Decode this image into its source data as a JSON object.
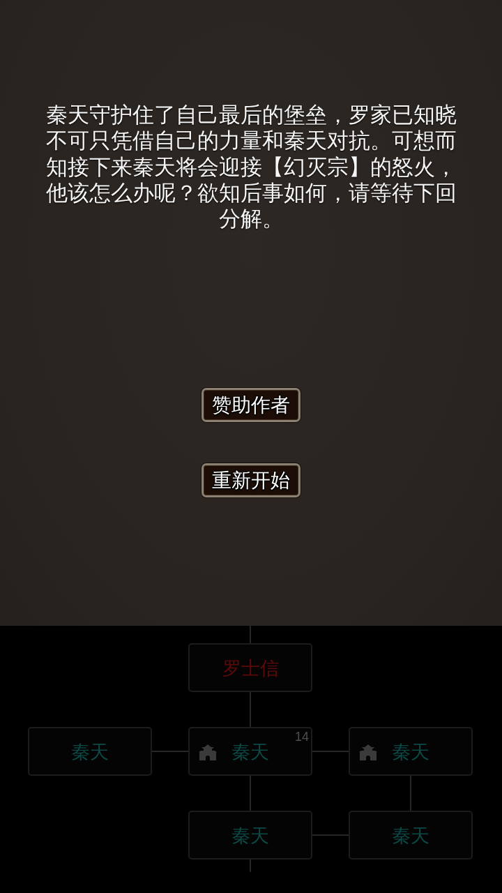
{
  "story": {
    "text": "秦天守护住了自己最后的堡垒，罗家已知晓不可只凭借自己的力量和秦天对抗。可想而知接下来秦天将会迎接【幻灭宗】的怒火，他该怎么办呢？欲知后事如何，请等待下回分解。"
  },
  "buttons": [
    {
      "label": "赞助作者"
    },
    {
      "label": "重新开始"
    }
  ],
  "map": {
    "nodes": [
      {
        "name": "罗士信",
        "color": "#5e0a0a",
        "gate": false,
        "connects_up": true,
        "connects_right": false,
        "connects_down": true
      },
      {
        "name": "秦天",
        "color": "#0c4a48",
        "gate": false,
        "connects_up": false,
        "connects_right": true,
        "connects_down": false
      },
      {
        "name": "秦天",
        "color": "#0c4a48",
        "gate": true,
        "count": "14",
        "connects_up": false,
        "connects_right": true,
        "connects_down": true
      },
      {
        "name": "秦天",
        "color": "#0c4a48",
        "gate": true,
        "connects_up": false,
        "connects_right": false,
        "connects_down": true
      },
      {
        "name": "秦天",
        "color": "#0c4a48",
        "gate": false,
        "connects_up": false,
        "connects_right": true,
        "connects_down": true
      },
      {
        "name": "秦天",
        "color": "#0c4a48",
        "gate": false,
        "connects_up": false,
        "connects_right": false,
        "connects_down": false
      }
    ]
  }
}
